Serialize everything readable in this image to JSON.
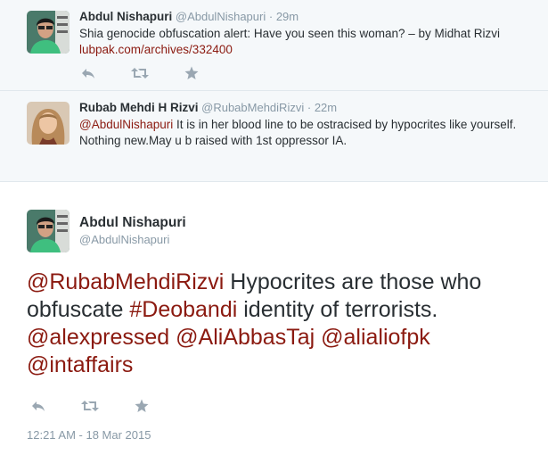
{
  "tweets": [
    {
      "fullname": "Abdul Nishapuri",
      "username": "@AbdulNishapuri",
      "separator": "·",
      "time": "29m",
      "text": "Shia genocide obfuscation alert: Have you seen this woman? – by Midhat Rizvi",
      "link": "lubpak.com/archives/332400"
    },
    {
      "fullname": "Rubab Mehdi H Rizvi",
      "username": "@RubabMehdiRizvi",
      "separator": "·",
      "time": "22m",
      "mention": "@AbdulNishapuri",
      "text": " It is in her blood line to be ostracised by hypocrites like yourself. Nothing new.May u b raised with 1st oppressor IA."
    }
  ],
  "main_tweet": {
    "fullname": "Abdul Nishapuri",
    "username": "@AbdulNishapuri",
    "mention1": "@RubabMehdiRizvi",
    "text1": " Hypocrites are those who obfuscate ",
    "hashtag": "#Deobandi",
    "text2": " identity of terrorists. ",
    "mention2": "@alexpressed",
    "mention3": "@AliAbbasTaj",
    "mention4": "@alialiofpk",
    "mention5": "@intaffairs",
    "timestamp": "12:21 AM - 18 Mar 2015"
  },
  "icons": {
    "reply": "reply-icon",
    "retweet": "retweet-icon",
    "favorite": "star-icon"
  },
  "colors": {
    "link": "#8b1a10",
    "muted": "#8899a6",
    "reply_bg": "#f5f8fa",
    "icon": "#9aa7b2"
  }
}
